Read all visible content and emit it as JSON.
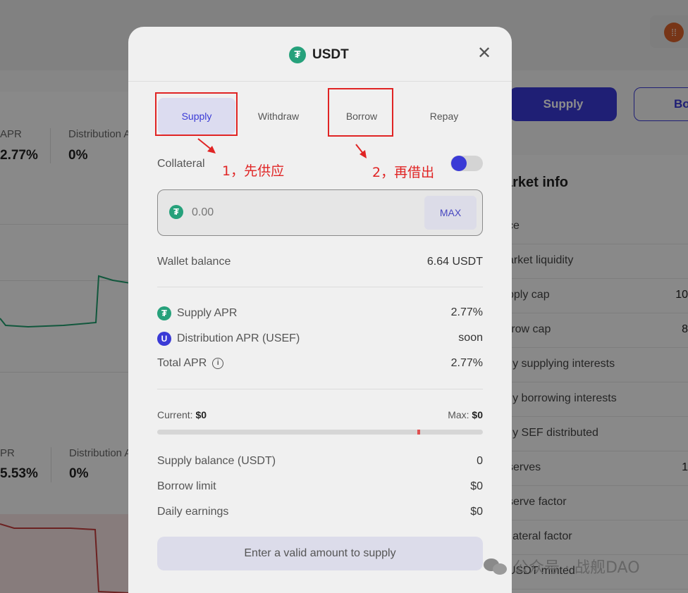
{
  "background": {
    "stats_top": [
      {
        "label": "APR",
        "value": "2.77%"
      },
      {
        "label": "Distribution A",
        "value": "0%"
      }
    ],
    "stats_bottom": [
      {
        "label": "PR",
        "value": "5.53%"
      },
      {
        "label": "Distribution A",
        "value": "0%"
      }
    ],
    "supply_button": "Supply",
    "borrow_button": "Bo",
    "market_info_title": "arket info",
    "market_rows": [
      {
        "label": "ce",
        "value": ""
      },
      {
        "label": "arket liquidity",
        "value": ""
      },
      {
        "label": "pply cap",
        "value": "10"
      },
      {
        "label": "rrow cap",
        "value": "8"
      },
      {
        "label": "ily supplying interests",
        "value": ""
      },
      {
        "label": "ily borrowing interests",
        "value": ""
      },
      {
        "label": "ily SEF distributed",
        "value": ""
      },
      {
        "label": "serves",
        "value": "1"
      },
      {
        "label": "serve factor",
        "value": ""
      },
      {
        "label": "llateral factor",
        "value": ""
      },
      {
        "label": "USDT minted",
        "value": ""
      }
    ]
  },
  "modal": {
    "title": "USDT",
    "token_glyph": "₮",
    "close_glyph": "✕",
    "tabs": [
      {
        "label": "Supply",
        "active": true
      },
      {
        "label": "Withdraw",
        "active": false
      },
      {
        "label": "Borrow",
        "active": false
      },
      {
        "label": "Repay",
        "active": false
      }
    ],
    "collateral_label": "Collateral",
    "collateral_on": true,
    "amount_placeholder": "0.00",
    "max_label": "MAX",
    "wallet_balance": {
      "label": "Wallet balance",
      "value": "6.64 USDT"
    },
    "supply_apr": {
      "label": "Supply APR",
      "value": "2.77%"
    },
    "distribution_apr": {
      "label": "Distribution APR (USEF)",
      "value": "soon",
      "glyph": "U"
    },
    "total_apr": {
      "label": "Total APR",
      "value": "2.77%",
      "info_glyph": "i"
    },
    "current": {
      "label": "Current:",
      "value": "$0"
    },
    "max": {
      "label": "Max:",
      "value": "$0"
    },
    "progress_marker_fraction": 0.805,
    "supply_balance": {
      "label": "Supply balance (USDT)",
      "value": "0"
    },
    "borrow_limit": {
      "label": "Borrow limit",
      "value": "$0"
    },
    "daily_earnings": {
      "label": "Daily earnings",
      "value": "$0"
    },
    "submit_label": "Enter a valid amount to supply"
  },
  "annotations": {
    "step1": "1，先供应",
    "step2": "2，再借出",
    "color": "#e02424"
  },
  "watermark": {
    "text": "公众号 · 战舰DAO"
  },
  "colors": {
    "accent": "#3a3ad6",
    "tether": "#26a17b",
    "supply_chart": "#1f9e6e",
    "borrow_chart": "#c43c3c"
  }
}
